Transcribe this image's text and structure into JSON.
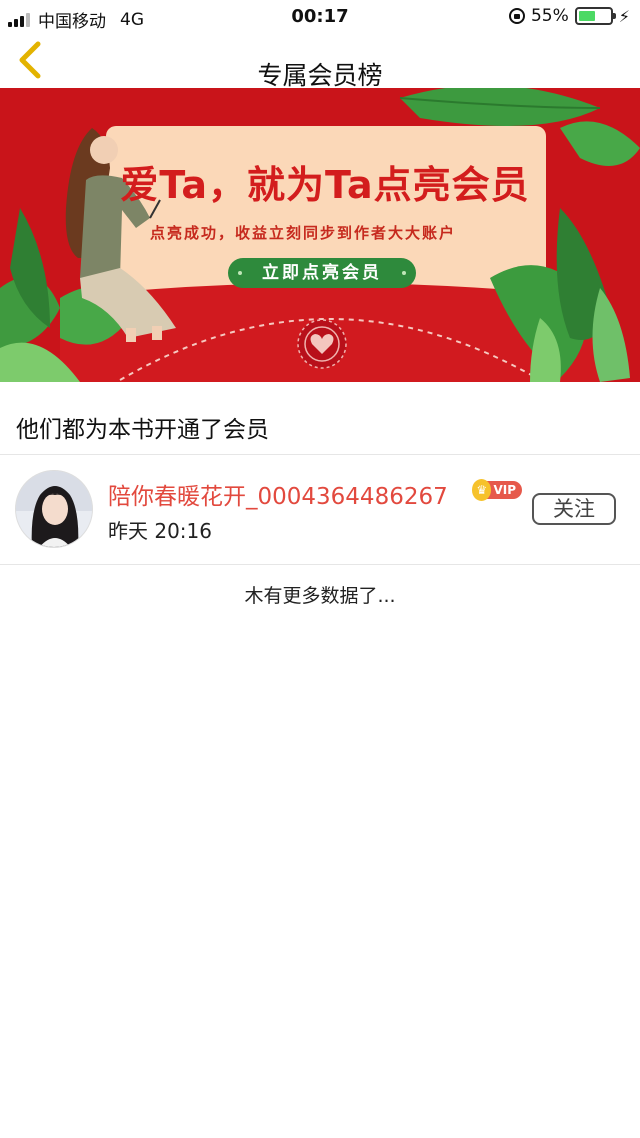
{
  "status_bar": {
    "carrier": "中国移动",
    "network": "4G",
    "time": "00:17",
    "battery": "55%",
    "battery_level": 0.55,
    "icons": [
      "signal-icon",
      "orientation-lock-icon",
      "battery-icon",
      "charging-bolt-icon"
    ]
  },
  "nav": {
    "title": "专属会员榜",
    "back_icon": "chevron-left-icon",
    "accent": "#e3b300"
  },
  "banner": {
    "headline": "爱Ta，就为Ta点亮会员",
    "subtitle": "点亮成功，收益立刻同步到作者大大账户",
    "button": "立即点亮会员",
    "colors": {
      "background": "#c9141a",
      "card": "#fbd8b8",
      "button": "#2e8a3c"
    }
  },
  "section": {
    "title": "他们都为本书开通了会员"
  },
  "members": [
    {
      "name": "陪你春暖花开_0004364486267",
      "badge": "VIP",
      "time": "昨天 20:16",
      "follow": "关注"
    }
  ],
  "footer": {
    "no_more": "木有更多数据了..."
  }
}
